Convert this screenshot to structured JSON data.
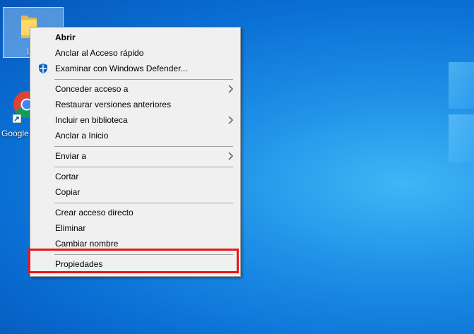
{
  "desktop": {
    "folder_label": "L",
    "chrome_label": "Google"
  },
  "context_menu": {
    "items": [
      {
        "label": "Abrir",
        "bold": true
      },
      {
        "label": "Anclar al Acceso rápido"
      },
      {
        "label": "Examinar con Windows Defender...",
        "icon": "shield-icon"
      },
      {
        "label": "Conceder acceso a",
        "submenu": true
      },
      {
        "label": "Restaurar versiones anteriores"
      },
      {
        "label": "Incluir en biblioteca",
        "submenu": true
      },
      {
        "label": "Anclar a Inicio"
      },
      {
        "label": "Enviar a",
        "submenu": true
      },
      {
        "label": "Cortar"
      },
      {
        "label": "Copiar"
      },
      {
        "label": "Crear acceso directo"
      },
      {
        "label": "Eliminar"
      },
      {
        "label": "Cambiar nombre"
      },
      {
        "label": "Propiedades",
        "highlighted": true
      }
    ]
  },
  "colors": {
    "highlight_border": "#e8151b",
    "menu_background": "#f0f0f0",
    "defender_blue": "#0a64c8"
  }
}
